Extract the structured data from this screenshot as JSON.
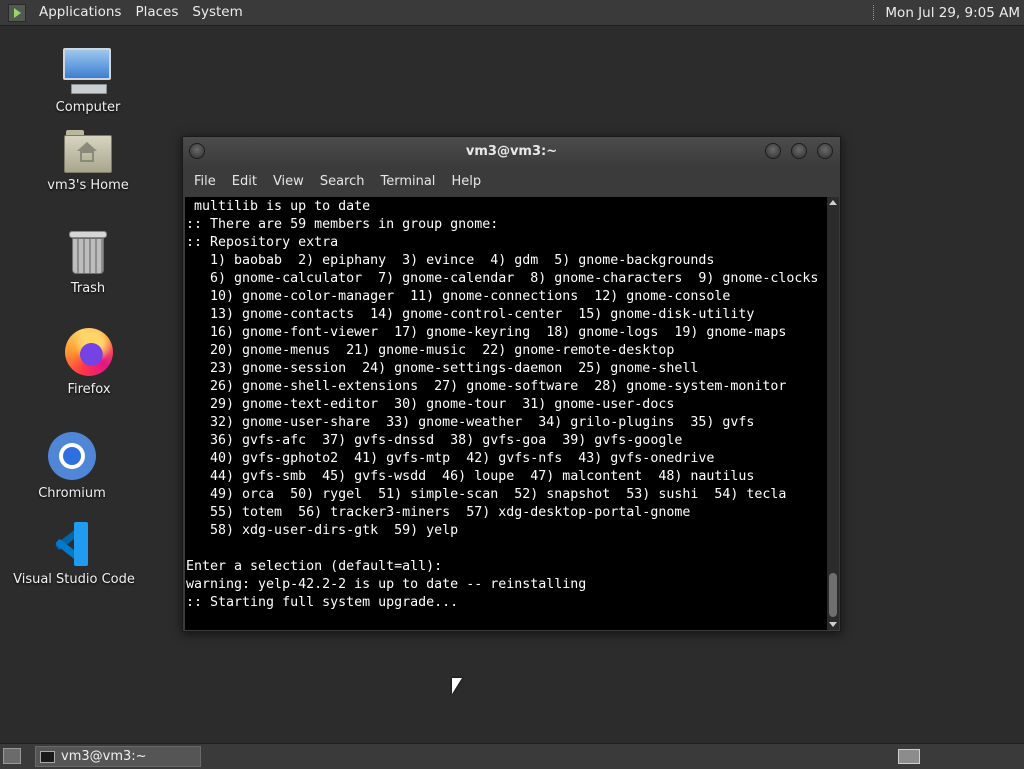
{
  "top_panel": {
    "menus": [
      "Applications",
      "Places",
      "System"
    ],
    "clock": "Mon Jul 29, 9:05 AM"
  },
  "desktop_icons": [
    {
      "label": "Computer",
      "icon": "computer-icon"
    },
    {
      "label": "vm3's Home",
      "icon": "home-folder-icon"
    },
    {
      "label": "Trash",
      "icon": "trash-icon"
    },
    {
      "label": "Firefox",
      "icon": "firefox-icon"
    },
    {
      "label": "Chromium",
      "icon": "chromium-icon"
    },
    {
      "label": "Visual Studio Code",
      "icon": "vscode-icon"
    }
  ],
  "terminal": {
    "title": "vm3@vm3:~",
    "menu": [
      "File",
      "Edit",
      "View",
      "Search",
      "Terminal",
      "Help"
    ],
    "output": " multilib is up to date\n:: There are 59 members in group gnome:\n:: Repository extra\n   1) baobab  2) epiphany  3) evince  4) gdm  5) gnome-backgrounds\n   6) gnome-calculator  7) gnome-calendar  8) gnome-characters  9) gnome-clocks\n   10) gnome-color-manager  11) gnome-connections  12) gnome-console\n   13) gnome-contacts  14) gnome-control-center  15) gnome-disk-utility\n   16) gnome-font-viewer  17) gnome-keyring  18) gnome-logs  19) gnome-maps\n   20) gnome-menus  21) gnome-music  22) gnome-remote-desktop\n   23) gnome-session  24) gnome-settings-daemon  25) gnome-shell\n   26) gnome-shell-extensions  27) gnome-software  28) gnome-system-monitor\n   29) gnome-text-editor  30) gnome-tour  31) gnome-user-docs\n   32) gnome-user-share  33) gnome-weather  34) grilo-plugins  35) gvfs\n   36) gvfs-afc  37) gvfs-dnssd  38) gvfs-goa  39) gvfs-google\n   40) gvfs-gphoto2  41) gvfs-mtp  42) gvfs-nfs  43) gvfs-onedrive\n   44) gvfs-smb  45) gvfs-wsdd  46) loupe  47) malcontent  48) nautilus\n   49) orca  50) rygel  51) simple-scan  52) snapshot  53) sushi  54) tecla\n   55) totem  56) tracker3-miners  57) xdg-desktop-portal-gnome\n   58) xdg-user-dirs-gtk  59) yelp\n\nEnter a selection (default=all):\nwarning: yelp-42.2-2 is up to date -- reinstalling\n:: Starting full system upgrade...",
    "scroll_position": 0.92
  },
  "taskbar": {
    "window_button": "vm3@vm3:~"
  }
}
